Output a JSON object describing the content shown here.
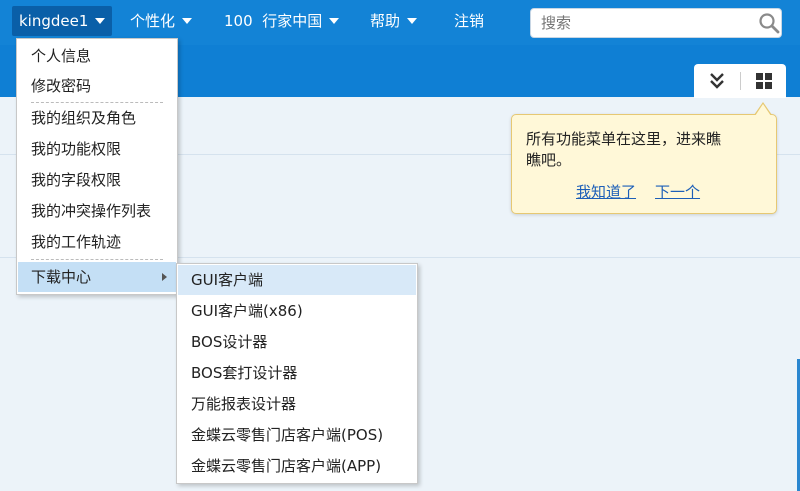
{
  "nav": {
    "user": "kingdee1",
    "personalize": "个性化",
    "org_code": "100",
    "org_name": "行家中国",
    "help": "帮助",
    "logout": "注销"
  },
  "search": {
    "placeholder": "搜索",
    "icon": "search-icon"
  },
  "view_toggle": {
    "collapse_icon": "double-chevron-down-icon",
    "grid_icon": "grid-icon"
  },
  "tooltip": {
    "line1": "所有功能菜单在这里，进来瞧",
    "line2": "瞧吧。",
    "ok": "我知道了",
    "next": "下一个"
  },
  "user_menu": {
    "items": [
      {
        "label": "个人信息"
      },
      {
        "label": "修改密码"
      },
      {
        "label": "我的组织及角色"
      },
      {
        "label": "我的功能权限"
      },
      {
        "label": "我的字段权限"
      },
      {
        "label": "我的冲突操作列表"
      },
      {
        "label": "我的工作轨迹"
      },
      {
        "label": "下载中心"
      }
    ]
  },
  "download_menu": {
    "items": [
      {
        "label": "GUI客户端"
      },
      {
        "label": "GUI客户端(x86)"
      },
      {
        "label": "BOS设计器"
      },
      {
        "label": "BOS套打设计器"
      },
      {
        "label": "万能报表设计器"
      },
      {
        "label": "金蝶云零售门店客户端(POS)"
      },
      {
        "label": "金蝶云零售门店客户端(APP)"
      }
    ]
  },
  "colors": {
    "topbar": "#1383d6",
    "menu_highlight": "#c4dff5",
    "tooltip_bg": "#fff8d8",
    "link": "#1d5fb8"
  }
}
